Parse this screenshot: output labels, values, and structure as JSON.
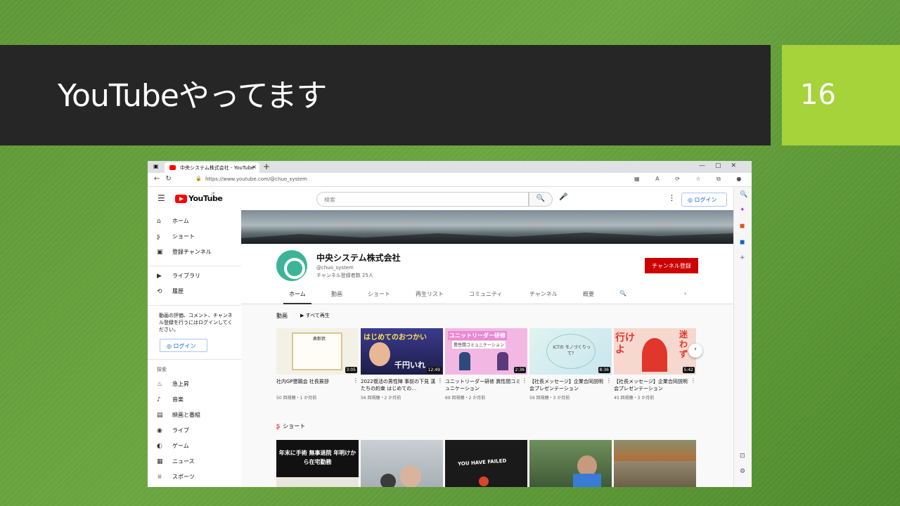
{
  "slide": {
    "title": "YouTubeやってます",
    "page_number": "16",
    "accent_color": "#a6d23a",
    "title_bar_color": "#262626"
  },
  "browser": {
    "tab_title": "中央システム株式会社 - YouTube",
    "url": "https://www.youtube.com/@chuo_system"
  },
  "youtube": {
    "logo_text": "YouTube",
    "logo_region": "JP",
    "search_placeholder": "検索",
    "login_label": "ログイン",
    "sidebar": {
      "items_top": [
        {
          "icon": "home-icon",
          "label": "ホーム"
        },
        {
          "icon": "shorts-icon",
          "label": "ショート"
        },
        {
          "icon": "subscriptions-icon",
          "label": "登録チャンネル"
        }
      ],
      "items_lib": [
        {
          "icon": "library-icon",
          "label": "ライブラリ"
        },
        {
          "icon": "history-icon",
          "label": "履歴"
        }
      ],
      "note": "動画の評価、コメント、チャンネル登録を行うにはログインしてください。",
      "login_label": "ログイン",
      "explore_label": "探索",
      "items_explore": [
        {
          "icon": "trending-icon",
          "label": "急上昇"
        },
        {
          "icon": "music-icon",
          "label": "音楽"
        },
        {
          "icon": "movies-icon",
          "label": "映画と番組"
        },
        {
          "icon": "live-icon",
          "label": "ライブ"
        },
        {
          "icon": "gaming-icon",
          "label": "ゲーム"
        },
        {
          "icon": "news-icon",
          "label": "ニュース"
        },
        {
          "icon": "sports-icon",
          "label": "スポーツ"
        }
      ]
    },
    "channel": {
      "name": "中央システム株式会社",
      "handle": "@chuo_system",
      "subscribers": "チャンネル登録者数 25人",
      "subscribe_label": "チャンネル登録",
      "tabs": [
        "ホーム",
        "動画",
        "ショート",
        "再生リスト",
        "コミュニティ",
        "チャンネル",
        "概要"
      ]
    },
    "videos_section": {
      "title": "動画",
      "play_all": "すべて再生"
    },
    "videos": [
      {
        "title": "社内GP懇親会 社長挨拶",
        "meta": "50 回視聴・1 か月前",
        "duration": "3:05",
        "thumb_text": "表彰状"
      },
      {
        "title": "2022復活の男性陣 事前の下見 漢たちの約束 はじめての…",
        "meta": "56 回視聴・2 か月前",
        "duration": "12:49",
        "thumb_text": "はじめてのおつかい",
        "thumb_sub": "千円いれ"
      },
      {
        "title": "ユニットリーダー研修 異性間コミュニケーション",
        "meta": "69 回視聴・2 か月前",
        "duration": "2:36",
        "thumb_text": "ユニットリーダー研修",
        "thumb_sub": "異性間コミュニケーション"
      },
      {
        "title": "【社長メッセージ】企業合同説明会プレゼンテーション",
        "meta": "59 回視聴・3 か月前",
        "duration": "8:36",
        "thumb_text": "ICTの モノづくりって？"
      },
      {
        "title": "【社長メッセージ】企業合同説明会プレゼンテーション",
        "meta": "45 回視聴・3 か月前",
        "duration": "5:42",
        "thumb_text": "行けよ",
        "thumb_sub": "迷わず"
      }
    ],
    "shorts_section": {
      "title": "ショート"
    },
    "shorts": [
      {
        "text": "年末に手術 無事退院 年明けから在宅勤務"
      },
      {
        "text": ""
      },
      {
        "text": "YOU HAVE FAILED"
      },
      {
        "text": ""
      },
      {
        "text": ""
      }
    ]
  }
}
